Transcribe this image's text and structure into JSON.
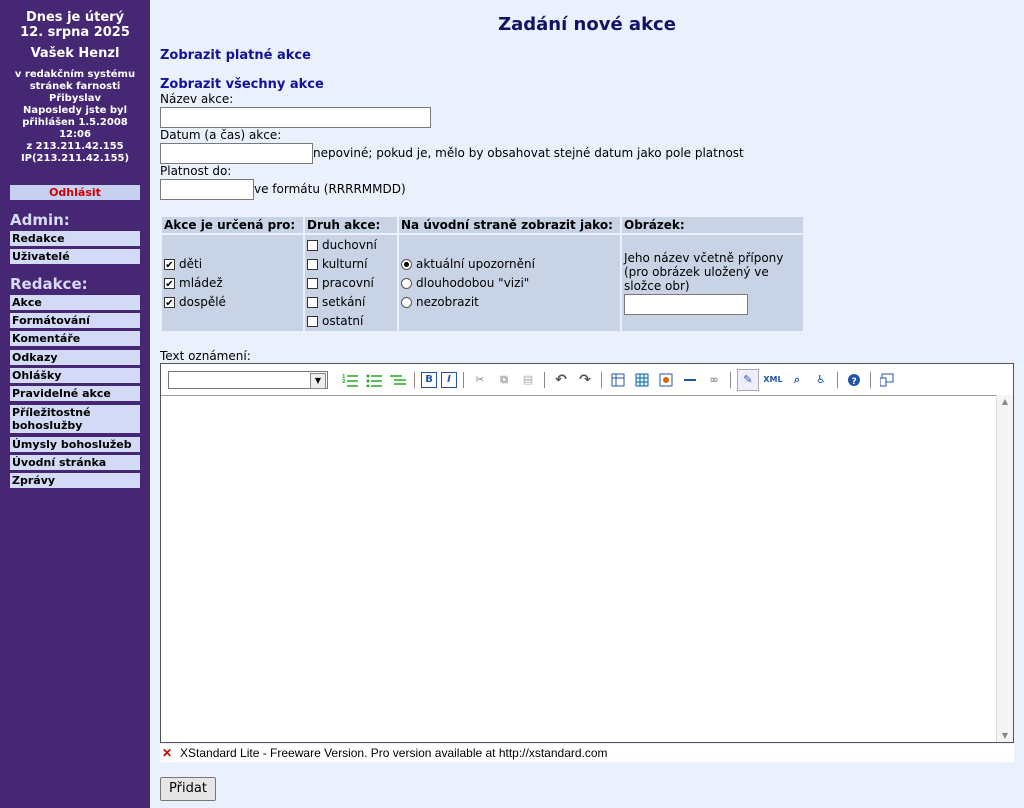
{
  "sidebar": {
    "date_line1": "Dnes je úterý",
    "date_line2": "12. srpna 2025",
    "user": "Vašek Henzl",
    "info": [
      "v redakčním systému",
      "stránek farnosti",
      "Přibyslav",
      "Naposledy jste byl",
      "přihlášen 1.5.2008",
      "12:06",
      "z 213.211.42.155",
      "IP(213.211.42.155)"
    ],
    "logout": "Odhlásit",
    "admin_title": "Admin:",
    "admin_items": [
      "Redakce",
      "Uživatelé"
    ],
    "redakce_title": "Redakce:",
    "redakce_items": [
      "Akce",
      "Formátování",
      "Komentáře",
      "Odkazy",
      "Ohlášky",
      "Pravidelné akce",
      "Příležitostné bohoslužby",
      "Úmysly bohoslužeb",
      "Úvodní stránka",
      "Zprávy"
    ]
  },
  "main": {
    "title": "Zadání nové akce",
    "link_valid": "Zobrazit platné akce",
    "link_all": "Zobrazit všechny akce",
    "name_label": "Název akce:",
    "name_value": "",
    "date_label": "Datum (a čas) akce:",
    "date_value": "",
    "date_note": "nepoviné; pokud je, mělo by obsahovat stejné datum jako pole platnost",
    "valid_label": "Platnost do:",
    "valid_value": "",
    "valid_note": "ve formátu (RRRRMMDD)",
    "table": {
      "headers": [
        "Akce je určená pro:",
        "Druh akce:",
        "Na úvodní straně zobrazit jako:",
        "Obrázek:"
      ],
      "audience": [
        {
          "label": "děti",
          "checked": true
        },
        {
          "label": "mládež",
          "checked": true
        },
        {
          "label": "dospělé",
          "checked": true
        }
      ],
      "types": [
        {
          "label": "duchovní",
          "checked": false
        },
        {
          "label": "kulturní",
          "checked": false
        },
        {
          "label": "pracovní",
          "checked": false
        },
        {
          "label": "setkání",
          "checked": false
        },
        {
          "label": "ostatní",
          "checked": false
        }
      ],
      "display": [
        {
          "label": "aktuální upozornění",
          "selected": true
        },
        {
          "label": "dlouhodobou \"vizi\"",
          "selected": false
        },
        {
          "label": "nezobrazit",
          "selected": false
        }
      ],
      "image_help": "Jeho název včetně přípony (pro obrázek uložený ve složce obr)",
      "image_value": ""
    },
    "text_label": "Text oznámení:",
    "editor_status": "XStandard Lite - Freeware Version.  Pro version available at http://xstandard.com",
    "submit": "Přidat"
  },
  "toolbar_icons": [
    "numbered-list-icon",
    "bullet-list-icon",
    "definition-list-icon",
    "bold-icon",
    "italic-icon",
    "cut-icon",
    "copy-icon",
    "paste-icon",
    "undo-icon",
    "redo-icon",
    "table-icon",
    "table-props-icon",
    "image-icon",
    "hr-icon",
    "link-icon",
    "edit-mode-icon",
    "xml-icon",
    "preview-icon",
    "accessibility-icon",
    "help-icon",
    "screen-reader-icon"
  ]
}
